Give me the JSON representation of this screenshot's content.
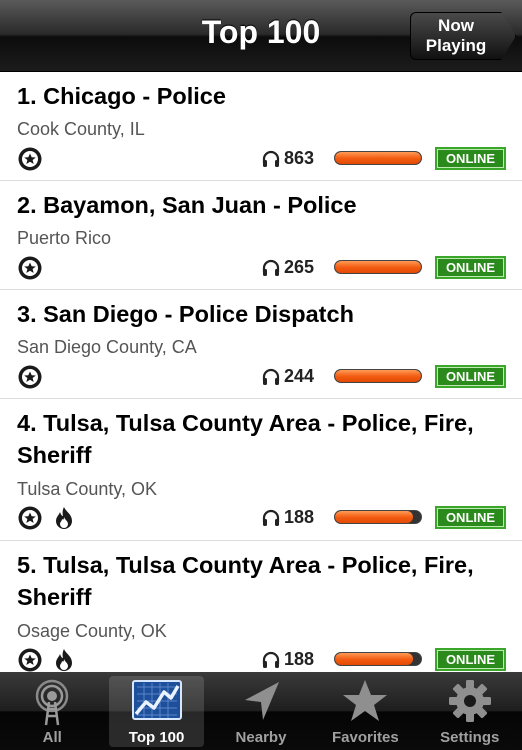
{
  "navbar": {
    "title": "Top 100",
    "now_playing": "Now\nPlaying"
  },
  "feeds": [
    {
      "title": "1. Chicago - Police",
      "subtitle": "Cook County, IL",
      "icons": [
        "police-badge-icon"
      ],
      "listeners": "863",
      "status": "ONLINE"
    },
    {
      "title": "2. Bayamon, San Juan - Police",
      "subtitle": "Puerto Rico",
      "icons": [
        "police-badge-icon"
      ],
      "listeners": "265",
      "status": "ONLINE"
    },
    {
      "title": "3. San Diego - Police Dispatch",
      "subtitle": "San Diego County, CA",
      "icons": [
        "police-badge-icon"
      ],
      "listeners": "244",
      "status": "ONLINE"
    },
    {
      "title": "4. Tulsa, Tulsa County Area - Police, Fire, Sheriff",
      "subtitle": "Tulsa County, OK",
      "icons": [
        "police-badge-icon",
        "fire-icon"
      ],
      "listeners": "188",
      "status": "ONLINE"
    },
    {
      "title": "5. Tulsa, Tulsa County Area - Police, Fire, Sheriff",
      "subtitle": "Osage County, OK",
      "icons": [
        "police-badge-icon",
        "fire-icon"
      ],
      "listeners": "188",
      "status": "ONLINE"
    }
  ],
  "colors": {
    "bar_fill": "#f25a10",
    "online_badge": "#2a8a1c"
  },
  "tabs": [
    {
      "label": "All",
      "icon": "radio-tower-icon"
    },
    {
      "label": "Top 100",
      "icon": "chart-icon",
      "active": true
    },
    {
      "label": "Nearby",
      "icon": "location-arrow-icon"
    },
    {
      "label": "Favorites",
      "icon": "star-icon"
    },
    {
      "label": "Settings",
      "icon": "gear-icon"
    }
  ]
}
